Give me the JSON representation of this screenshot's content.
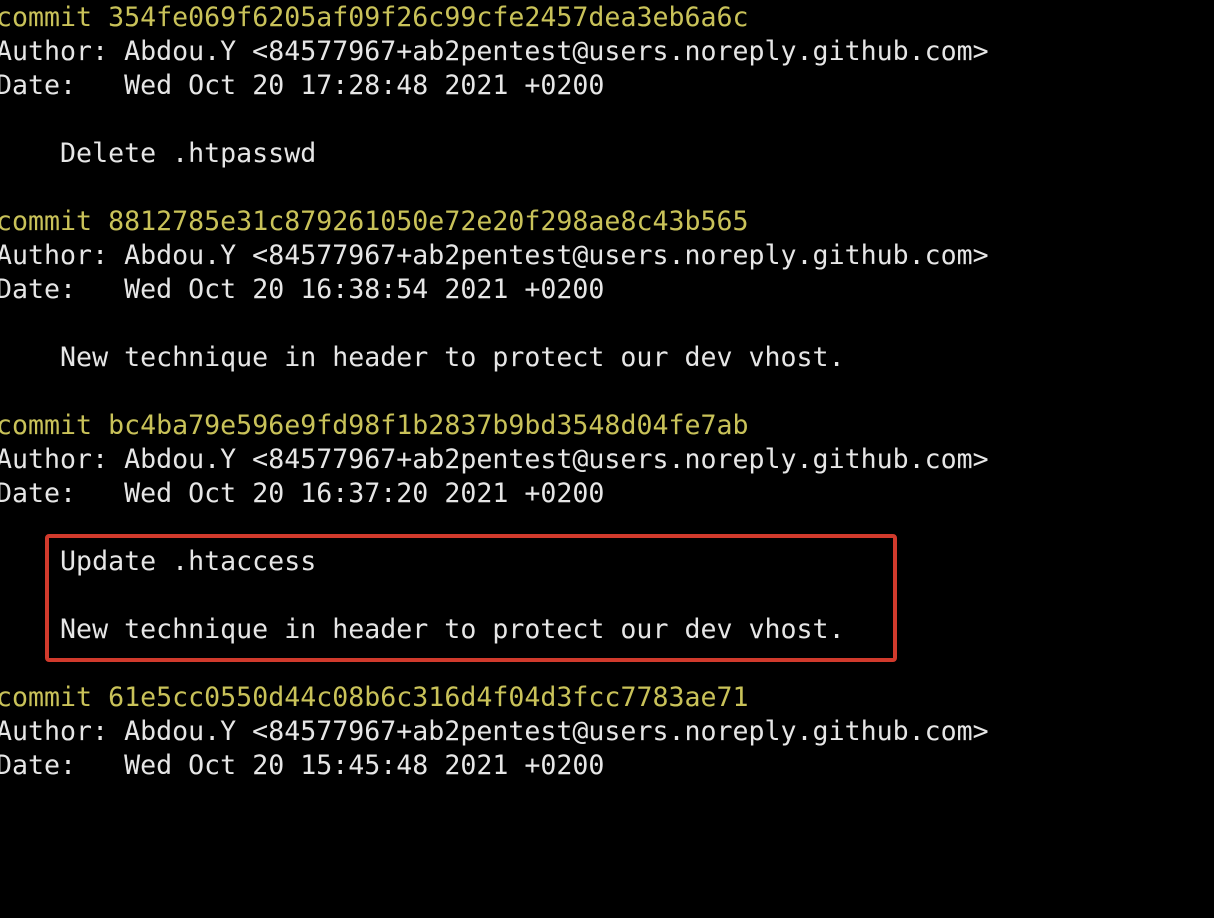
{
  "commits": [
    {
      "commit_label": "commit",
      "hash": "354fe069f6205af09f26c99cfe2457dea3eb6a6c",
      "author_label": "Author:",
      "author": "Abdou.Y <84577967+ab2pentest@users.noreply.github.com>",
      "date_label": "Date:",
      "date": "Wed Oct 20 17:28:48 2021 +0200",
      "message": [
        "Delete .htpasswd"
      ]
    },
    {
      "commit_label": "commit",
      "hash": "8812785e31c879261050e72e20f298ae8c43b565",
      "author_label": "Author:",
      "author": "Abdou.Y <84577967+ab2pentest@users.noreply.github.com>",
      "date_label": "Date:",
      "date": "Wed Oct 20 16:38:54 2021 +0200",
      "message": [
        "New technique in header to protect our dev vhost."
      ]
    },
    {
      "commit_label": "commit",
      "hash": "bc4ba79e596e9fd98f1b2837b9bd3548d04fe7ab",
      "author_label": "Author:",
      "author": "Abdou.Y <84577967+ab2pentest@users.noreply.github.com>",
      "date_label": "Date:",
      "date": "Wed Oct 20 16:37:20 2021 +0200",
      "message": [
        "Update .htaccess",
        "",
        "New technique in header to protect our dev vhost."
      ]
    },
    {
      "commit_label": "commit",
      "hash": "61e5cc0550d44c08b6c316d4f04d3fcc7783ae71",
      "author_label": "Author:",
      "author": "Abdou.Y <84577967+ab2pentest@users.noreply.github.com>",
      "date_label": "Date:",
      "date": "Wed Oct 20 15:45:48 2021 +0200",
      "message": []
    }
  ],
  "colors": {
    "background": "#000000",
    "text": "#e6e6e6",
    "commit_hash": "#c9c259",
    "highlight_border": "#d13a2c"
  }
}
